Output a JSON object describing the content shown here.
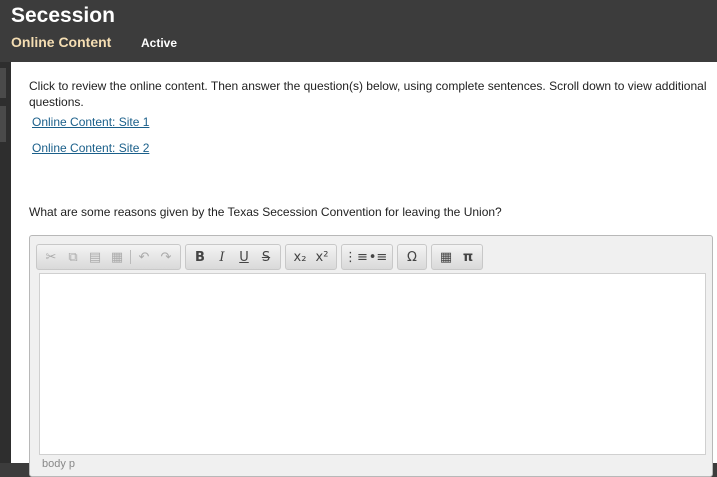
{
  "header": {
    "title": "Secession",
    "section": "Online Content",
    "status": "Active"
  },
  "instructions": "Click to review the online content. Then answer the question(s) below, using complete sentences. Scroll down to view additional questions.",
  "links": [
    "Online Content: Site 1",
    "Online Content: Site 2"
  ],
  "question": "What are some reasons given by the Texas Secession Convention for leaving the Union?",
  "editor": {
    "toolbar_icons": [
      "cut-icon",
      "copy-icon",
      "paste-icon",
      "paste-text-icon",
      "undo-icon",
      "redo-icon",
      "bold-icon",
      "italic-icon",
      "underline-icon",
      "strikethrough-icon",
      "subscript-icon",
      "superscript-icon",
      "numbered-list-icon",
      "bulleted-list-icon",
      "special-character-icon",
      "table-icon",
      "math-icon"
    ],
    "content": "",
    "path": "body p"
  }
}
